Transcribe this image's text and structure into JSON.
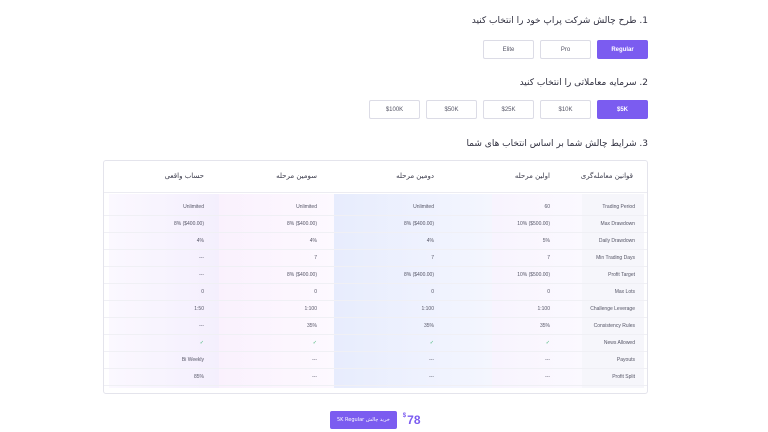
{
  "step1": {
    "title": "1. طرح چالش شرکت پراپ خود را انتخاب کنید",
    "options": [
      "Regular",
      "Pro",
      "Elite"
    ],
    "selected": "Regular"
  },
  "step2": {
    "title": "2. سرمایه معاملاتی را انتخاب کنید",
    "options": [
      "$5K",
      "$10K",
      "$25K",
      "$50K",
      "$100K"
    ],
    "selected": "$5K"
  },
  "step3": {
    "title": "3. شرایط چالش شما بر اساس انتخاب های شما"
  },
  "table": {
    "headers": {
      "rules": "قوانین معامله‌گری",
      "phase1": "اولین مرحله",
      "phase2": "دومین مرحله",
      "phase3": "سومین مرحله",
      "real": "حساب واقعی"
    },
    "rows": [
      {
        "label": "Trading Period",
        "p1": "60",
        "p2": "Unlimited",
        "p3": "Unlimited",
        "real": "Unlimited"
      },
      {
        "label": "Max Drawdown",
        "p1": "10% ($500.00)",
        "p2": "8% ($400.00)",
        "p3": "8% ($400.00)",
        "real": "8% ($400.00)"
      },
      {
        "label": "Daily Drawdown",
        "p1": "5%",
        "p2": "4%",
        "p3": "4%",
        "real": "4%"
      },
      {
        "label": "Min Trading Days",
        "p1": "7",
        "p2": "7",
        "p3": "7",
        "real": "---"
      },
      {
        "label": "Profit Target",
        "p1": "10% ($500.00)",
        "p2": "8% ($400.00)",
        "p3": "8% ($400.00)",
        "real": "---"
      },
      {
        "label": "Max Lots",
        "p1": "0",
        "p2": "0",
        "p3": "0",
        "real": "0"
      },
      {
        "label": "Challenge Leverage",
        "p1": "1:100",
        "p2": "1:100",
        "p3": "1:100",
        "real": "1:50"
      },
      {
        "label": "Consistency Rules",
        "p1": "35%",
        "p2": "35%",
        "p3": "35%",
        "real": "---"
      },
      {
        "label": "News Allowed",
        "p1": "✓",
        "p2": "✓",
        "p3": "✓",
        "real": "✓"
      },
      {
        "label": "Payouts",
        "p1": "---",
        "p2": "---",
        "p3": "---",
        "real": "Bi Weekly"
      },
      {
        "label": "Profit Split",
        "p1": "---",
        "p2": "---",
        "p3": "---",
        "real": "85%"
      }
    ]
  },
  "footer": {
    "buy_label": "خرید چالش 5K Regular",
    "price": "78",
    "currency": "$"
  },
  "colors": {
    "accent": "#7b5cf0",
    "check": "#3cb371"
  }
}
